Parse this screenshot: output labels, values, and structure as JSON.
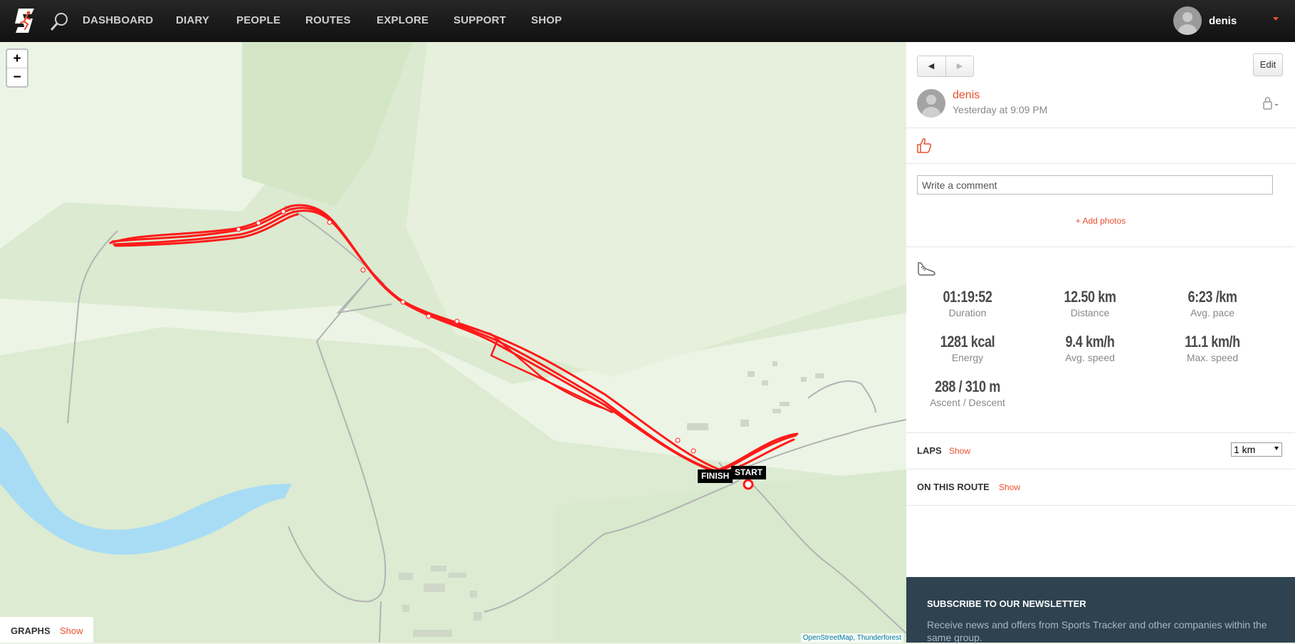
{
  "nav": {
    "items": [
      "DASHBOARD",
      "DIARY",
      "PEOPLE",
      "ROUTES",
      "EXPLORE",
      "SUPPORT",
      "SHOP"
    ],
    "user_name": "denis"
  },
  "map": {
    "zoom_in": "+",
    "zoom_out": "−",
    "finish_label": "FINISH",
    "start_label": "START",
    "attribution": "OpenStreetMap, Thunderforest",
    "graphs_label": "GRAPHS",
    "graphs_show": "Show",
    "route_color": "#ff1a1a"
  },
  "panel": {
    "prev": "◀",
    "next": "▶",
    "edit": "Edit",
    "owner_name": "denis",
    "owner_date": "Yesterday at 9:09 PM",
    "comment_placeholder": "Write a comment",
    "add_photos": "+ Add photos",
    "stats": [
      {
        "value": "01:19:52",
        "label": "Duration"
      },
      {
        "value": "12.50 km",
        "label": "Distance"
      },
      {
        "value": "6:23 /km",
        "label": "Avg. pace"
      },
      {
        "value": "1281 kcal",
        "label": "Energy"
      },
      {
        "value": "9.4 km/h",
        "label": "Avg. speed"
      },
      {
        "value": "11.1 km/h",
        "label": "Max. speed"
      },
      {
        "value": "288 / 310 m",
        "label": "Ascent / Descent"
      }
    ],
    "laps_label": "LAPS",
    "laps_show": "Show",
    "lap_select": "1 km",
    "route_label": "ON THIS ROUTE",
    "route_show": "Show",
    "newsletter_title": "SUBSCRIBE TO OUR NEWSLETTER",
    "newsletter_text": "Receive news and offers from Sports Tracker and other companies within the same group."
  }
}
